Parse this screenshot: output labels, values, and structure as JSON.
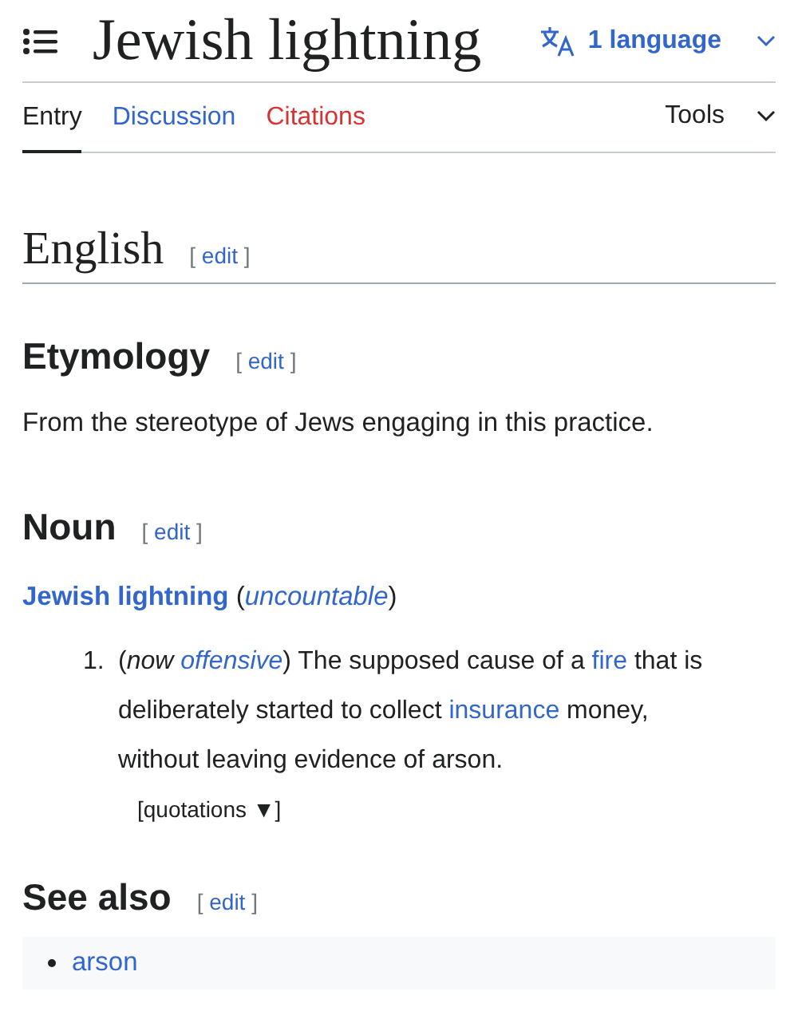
{
  "header": {
    "title": "Jewish lightning",
    "language_button": "1 language"
  },
  "tabs": [
    {
      "label": "Entry",
      "selected": true,
      "kind": "page"
    },
    {
      "label": "Discussion",
      "selected": false,
      "kind": "page"
    },
    {
      "label": "Citations",
      "selected": false,
      "kind": "missing"
    }
  ],
  "tools": "Tools",
  "language_heading": {
    "title": "English",
    "edit": {
      "open": "[",
      "label": "edit",
      "close": "]"
    }
  },
  "etymology": {
    "title": "Etymology",
    "edit": {
      "open": "[",
      "label": "edit",
      "close": "]"
    },
    "text": "From the stereotype of Jews engaging in this practice."
  },
  "noun": {
    "title": "Noun",
    "edit": {
      "open": "[",
      "label": "edit",
      "close": "]"
    },
    "headword": "Jewish lightning",
    "headword_note": [
      {
        "kind": "plain",
        "text": "("
      },
      {
        "kind": "italic_link",
        "text": "uncountable"
      },
      {
        "kind": "plain",
        "text": ")"
      }
    ],
    "definitions": [
      {
        "number": "1.",
        "segments": [
          {
            "kind": "plain",
            "text": "("
          },
          {
            "kind": "italic",
            "text": "now "
          },
          {
            "kind": "italic_link",
            "text": "offensive"
          },
          {
            "kind": "plain",
            "text": ") The supposed cause of a "
          },
          {
            "kind": "link",
            "text": "fire"
          },
          {
            "kind": "plain",
            "text": " that is deliberately started to collect "
          },
          {
            "kind": "link",
            "text": "insurance"
          },
          {
            "kind": "plain",
            "text": " money, without leaving evidence of arson."
          }
        ],
        "quotations": {
          "open": "[",
          "label": "quotations",
          "arrow": "▼",
          "close": "]"
        }
      }
    ]
  },
  "see_also": {
    "title": "See also",
    "edit": {
      "open": "[",
      "label": "edit",
      "close": "]"
    },
    "items": [
      "arson"
    ]
  }
}
